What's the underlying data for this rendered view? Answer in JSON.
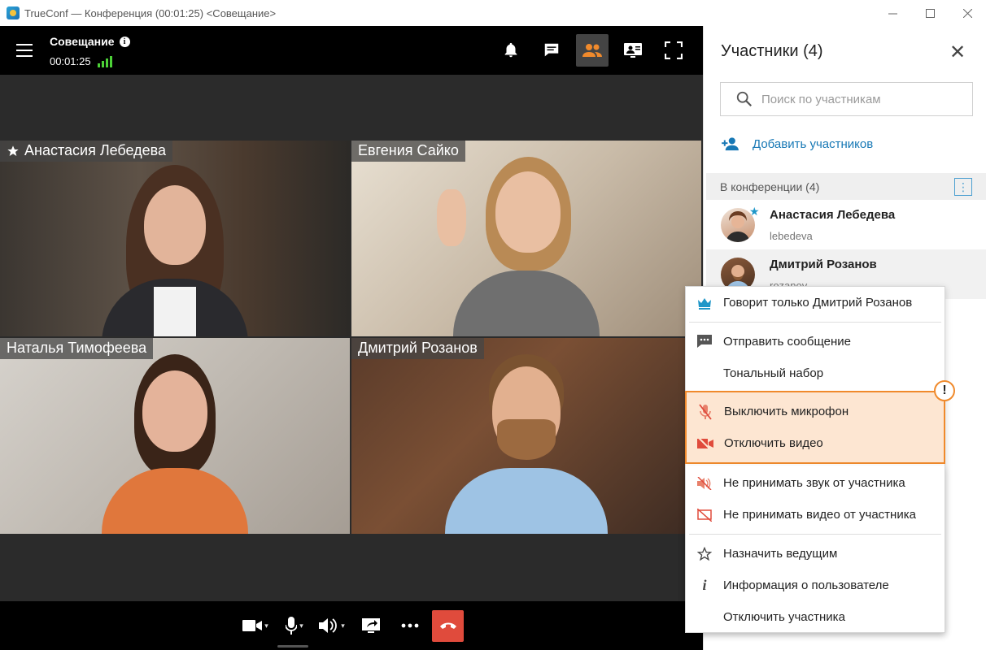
{
  "window": {
    "title": "TrueConf — Конференция (00:01:25) <Совещание>",
    "controls": [
      "minimize",
      "maximize",
      "close"
    ]
  },
  "conference": {
    "name": "Совещание",
    "timer": "00:01:25",
    "signal_color": "#4cd137"
  },
  "toolbar": {
    "icons": [
      "bell-icon",
      "chat-icon",
      "participants-icon",
      "slideshow-icon",
      "fullscreen-icon"
    ],
    "active": "participants-icon",
    "active_color": "#f08a2c"
  },
  "tiles": [
    {
      "name": "Анастасия Лебедева",
      "moderator": true
    },
    {
      "name": "Евгения Сайко",
      "moderator": false
    },
    {
      "name": "Наталья Тимофеева",
      "moderator": false
    },
    {
      "name": "Дмитрий Розанов",
      "moderator": false
    }
  ],
  "bottom_controls": [
    "camera-icon",
    "microphone-icon",
    "speaker-icon",
    "screen-share-icon",
    "more-icon",
    "hangup-icon"
  ],
  "hangup_color": "#e04b3c",
  "panel": {
    "title": "Участники (4)",
    "search_placeholder": "Поиск по участникам",
    "add_label": "Добавить участников",
    "section_label": "В конференции (4)",
    "accent_color": "#1778b5",
    "participants": [
      {
        "name": "Анастасия Лебедева",
        "login": "lebedeva",
        "moderator": true
      },
      {
        "name": "Дмитрий Розанов",
        "login": "rozanov",
        "moderator": false
      }
    ]
  },
  "context_menu": {
    "items": [
      {
        "label": "Говорит только Дмитрий Розанов",
        "icon": "crown-icon"
      },
      {
        "label": "Отправить сообщение",
        "icon": "message-icon"
      },
      {
        "label": "Тональный набор",
        "icon": null
      },
      {
        "label": "Выключить микрофон",
        "icon": "mic-off-icon",
        "highlighted": true
      },
      {
        "label": "Отключить видео",
        "icon": "video-off-icon",
        "highlighted": true
      },
      {
        "label": "Не принимать звук от участника",
        "icon": "speaker-off-icon"
      },
      {
        "label": "Не принимать видео от участника",
        "icon": "monitor-off-icon"
      },
      {
        "label": "Назначить ведущим",
        "icon": "star-icon"
      },
      {
        "label": "Информация о пользователе",
        "icon": "info-icon"
      },
      {
        "label": "Отключить участника",
        "icon": null
      }
    ],
    "highlight_color": "#f08a2c",
    "warning_mark": "!"
  }
}
